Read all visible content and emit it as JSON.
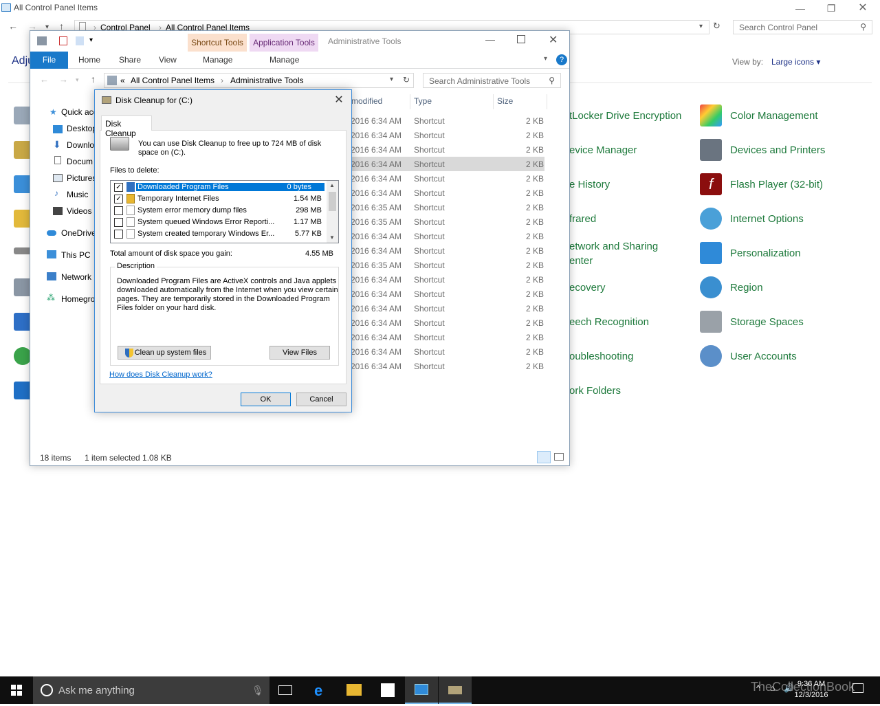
{
  "control_panel": {
    "title": "All Control Panel Items",
    "breadcrumb": [
      "Control Panel",
      "All Control Panel Items"
    ],
    "search_placeholder": "Search Control Panel",
    "heading_partial": "Adju",
    "view_by_label": "View by:",
    "view_by_value": "Large icons ▾",
    "items_col3": [
      "tLocker Drive Encryption",
      "evice Manager",
      "e History",
      "frared",
      "etwork and Sharing",
      "enter",
      "ecovery",
      "eech Recognition",
      "oubleshooting",
      "ork Folders"
    ],
    "items_col4": [
      "Color Management",
      "Devices and Printers",
      "Flash Player (32-bit)",
      "Internet Options",
      "Personalization",
      "Region",
      "Storage Spaces",
      "User Accounts"
    ]
  },
  "explorer": {
    "title": "Administrative Tools",
    "ctx_tab_shortcut": "Shortcut Tools",
    "ctx_tab_application": "Application Tools",
    "ribbon_tabs": [
      "File",
      "Home",
      "Share",
      "View",
      "Manage",
      "Manage"
    ],
    "address": [
      "«",
      "All Control Panel Items",
      "›",
      "Administrative Tools"
    ],
    "search_placeholder": "Search Administrative Tools",
    "nav": [
      "Quick acc",
      "Desktop",
      "Downlo",
      "Docum",
      "Pictures",
      "Music",
      "Videos",
      "OneDrive",
      "This PC",
      "Network",
      "Homegro"
    ],
    "columns": [
      "modified",
      "Type",
      "Size"
    ],
    "rows": [
      {
        "date": "2016 6:34 AM",
        "type": "Shortcut",
        "size": "2 KB"
      },
      {
        "date": "2016 6:34 AM",
        "type": "Shortcut",
        "size": "2 KB"
      },
      {
        "date": "2016 6:34 AM",
        "type": "Shortcut",
        "size": "2 KB"
      },
      {
        "date": "2016 6:34 AM",
        "type": "Shortcut",
        "size": "2 KB"
      },
      {
        "date": "2016 6:34 AM",
        "type": "Shortcut",
        "size": "2 KB"
      },
      {
        "date": "2016 6:34 AM",
        "type": "Shortcut",
        "size": "2 KB"
      },
      {
        "date": "2016 6:35 AM",
        "type": "Shortcut",
        "size": "2 KB"
      },
      {
        "date": "2016 6:35 AM",
        "type": "Shortcut",
        "size": "2 KB"
      },
      {
        "date": "2016 6:34 AM",
        "type": "Shortcut",
        "size": "2 KB"
      },
      {
        "date": "2016 6:34 AM",
        "type": "Shortcut",
        "size": "2 KB"
      },
      {
        "date": "2016 6:35 AM",
        "type": "Shortcut",
        "size": "2 KB"
      },
      {
        "date": "2016 6:34 AM",
        "type": "Shortcut",
        "size": "2 KB"
      },
      {
        "date": "2016 6:34 AM",
        "type": "Shortcut",
        "size": "2 KB"
      },
      {
        "date": "2016 6:34 AM",
        "type": "Shortcut",
        "size": "2 KB"
      },
      {
        "date": "2016 6:34 AM",
        "type": "Shortcut",
        "size": "2 KB"
      },
      {
        "date": "2016 6:34 AM",
        "type": "Shortcut",
        "size": "2 KB"
      },
      {
        "date": "2016 6:34 AM",
        "type": "Shortcut",
        "size": "2 KB"
      },
      {
        "date": "2016 6:34 AM",
        "type": "Shortcut",
        "size": "2 KB"
      }
    ],
    "selected_row_index": 3,
    "status_items": "18 items",
    "status_selected": "1 item selected  1.08 KB"
  },
  "dialog": {
    "title": "Disk Cleanup for  (C:)",
    "tab": "Disk Cleanup",
    "intro_line1": "You can use Disk Cleanup to free up to 724 MB of disk",
    "intro_line2": "space on  (C:).",
    "files_label": "Files to delete:",
    "files": [
      {
        "name": "Downloaded Program Files",
        "size": "0 bytes",
        "checked": true,
        "selected": true
      },
      {
        "name": "Temporary Internet Files",
        "size": "1.54 MB",
        "checked": true,
        "selected": false
      },
      {
        "name": "System error memory dump files",
        "size": "298 MB",
        "checked": false,
        "selected": false
      },
      {
        "name": "System queued Windows Error Reporti...",
        "size": "1.17 MB",
        "checked": false,
        "selected": false
      },
      {
        "name": "System created temporary Windows Er...",
        "size": "5.77 KB",
        "checked": false,
        "selected": false
      }
    ],
    "total_label": "Total amount of disk space you gain:",
    "total_value": "4.55 MB",
    "desc_label": "Description",
    "desc_lines": [
      "Downloaded Program Files are ActiveX controls and Java applets",
      "downloaded automatically from the Internet when you view certain",
      "pages. They are temporarily stored in the Downloaded Program",
      "Files folder on your hard disk."
    ],
    "cleanup_btn": "Clean up system files",
    "viewfiles_btn": "View Files",
    "help_link": "How does Disk Cleanup work?",
    "ok_btn": "OK",
    "cancel_btn": "Cancel"
  },
  "taskbar": {
    "search_placeholder": "Ask me anything",
    "time": "9:36 AM",
    "date": "12/3/2016",
    "watermark": "TheCollectionBook"
  }
}
